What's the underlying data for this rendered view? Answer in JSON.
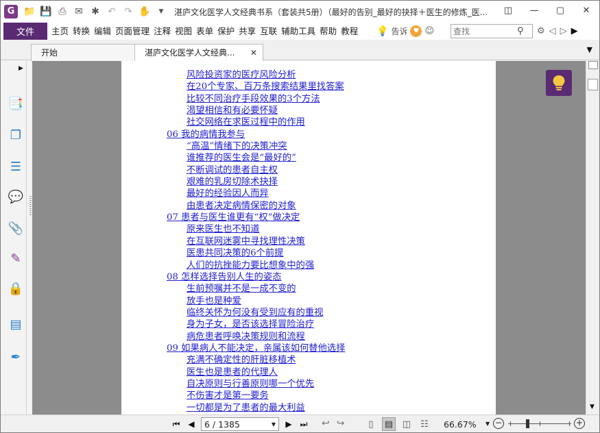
{
  "window": {
    "title": "湛庐文化医学人文经典书系（套装共5册）（最好的告别_最好的抉择＋医生的修炼_医..."
  },
  "menubar": {
    "file": "文件",
    "items": [
      "主页",
      "转换",
      "编辑",
      "页面管理",
      "注释",
      "视图",
      "表单",
      "保护",
      "共享",
      "互联",
      "辅助工具",
      "帮助",
      "教程"
    ],
    "tell_me": "告诉",
    "search_placeholder": "查找"
  },
  "tabs": [
    {
      "label": "开始",
      "active": false
    },
    {
      "label": "湛庐文化医学人文经典...",
      "active": true
    }
  ],
  "document": {
    "toc": [
      {
        "text": "风险投资家的医疗风险分析",
        "level": 2
      },
      {
        "text": "在20个专家、百万条搜索结果里找答案",
        "level": 2
      },
      {
        "text": "比较不同治疗手段效果的3个方法",
        "level": 2
      },
      {
        "text": "渴望相信和有必要怀疑",
        "level": 2
      },
      {
        "text": "社交网络在求医过程中的作用",
        "level": 2
      },
      {
        "text": "06 我的病情我参与",
        "level": 1
      },
      {
        "text": "“高温”情绪下的决策冲突",
        "level": 2
      },
      {
        "text": "谁推荐的医生会是“最好的”",
        "level": 2
      },
      {
        "text": "不断调试的患者自主权",
        "level": 2
      },
      {
        "text": "艰难的乳房切除术抉择",
        "level": 2
      },
      {
        "text": "最好的经验因人而异",
        "level": 2
      },
      {
        "text": "由患者决定病情保密的对象",
        "level": 2
      },
      {
        "text": "07 患者与医生谁更有“权”做决定",
        "level": 1
      },
      {
        "text": "原来医生也不知道",
        "level": 2
      },
      {
        "text": "在互联网迷雾中寻找理性决策",
        "level": 2
      },
      {
        "text": "医患共同决策的6个前提",
        "level": 2
      },
      {
        "text": "人们的抗挫能力要比想象中的强",
        "level": 2
      },
      {
        "text": "08 怎样选择告别人生的姿态",
        "level": 1
      },
      {
        "text": "生前预嘱并不是一成不变的",
        "level": 2
      },
      {
        "text": "放手也是种爱",
        "level": 2
      },
      {
        "text": "临终关怀为何没有受到应有的重视",
        "level": 2
      },
      {
        "text": "身为子女，是否该选择冒险治疗",
        "level": 2
      },
      {
        "text": "病危患者呼唤决策规则和流程",
        "level": 2
      },
      {
        "text": "09 如果病人不能决定，亲属该如何替他选择",
        "level": 1
      },
      {
        "text": "充满不确定性的肝脏移植术",
        "level": 2
      },
      {
        "text": "医生也是患者的代理人",
        "level": 2
      },
      {
        "text": "自决原则与行善原则哪一个优先",
        "level": 2
      },
      {
        "text": "不伤害才是第一要务",
        "level": 2
      },
      {
        "text": "一切都是为了患者的最大利益",
        "level": 2
      }
    ]
  },
  "status": {
    "page_indicator": "6 / 1385",
    "zoom": "66.67%"
  },
  "colors": {
    "brand": "#5a2a73",
    "link": "#1f1fd0",
    "canvas": "#8c8c8c"
  }
}
